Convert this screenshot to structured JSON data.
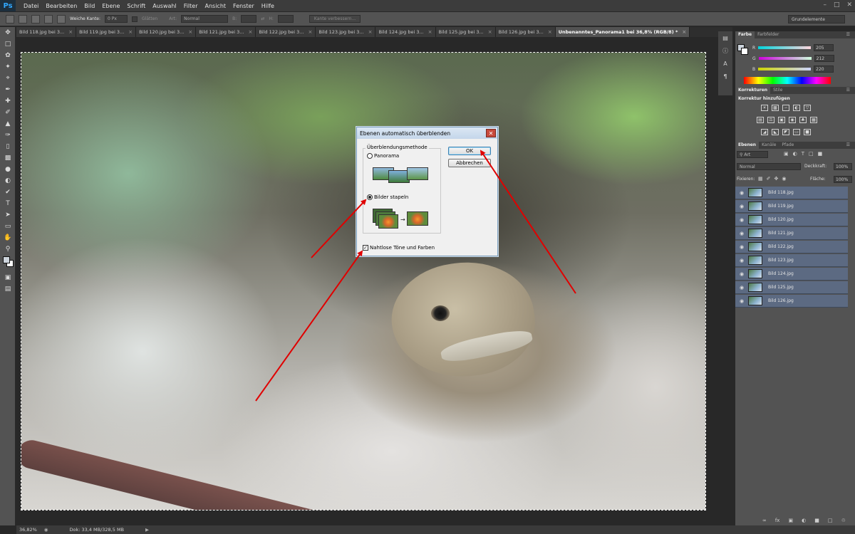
{
  "app": {
    "logo": "Ps",
    "menu": [
      "Datei",
      "Bearbeiten",
      "Bild",
      "Ebene",
      "Schrift",
      "Auswahl",
      "Filter",
      "Ansicht",
      "Fenster",
      "Hilfe"
    ]
  },
  "options": {
    "feather_label": "Weiche Kante:",
    "feather_value": "0 Px",
    "smooth_label": "Glätten",
    "style_label": "Art:",
    "style_value": "Normal",
    "width_label": "B:",
    "height_label": "H:",
    "refine_button": "Kante verbessern...",
    "workspace": "Grundelemente"
  },
  "tabs": [
    {
      "label": "Bild 118.jpg bei 3..."
    },
    {
      "label": "Bild 119.jpg bei 3..."
    },
    {
      "label": "Bild 120.jpg bei 3..."
    },
    {
      "label": "Bild 121.jpg bei 3..."
    },
    {
      "label": "Bild 122.jpg bei 3..."
    },
    {
      "label": "Bild 123.jpg bei 3..."
    },
    {
      "label": "Bild 124.jpg bei 3..."
    },
    {
      "label": "Bild 125.jpg bei 3..."
    },
    {
      "label": "Bild 126.jpg bei 3..."
    },
    {
      "label": "Unbenanntes_Panorama1 bei 36,8% (RGB/8) *"
    }
  ],
  "dialog": {
    "title": "Ebenen automatisch überblenden",
    "group_label": "Überblendungsmethode",
    "option_panorama": "Panorama",
    "option_stack": "Bilder stapeln",
    "checkbox_label": "Nahtlose Töne und Farben",
    "ok": "OK",
    "cancel": "Abbrechen",
    "selected": "Bilder stapeln",
    "checkbox_checked": true
  },
  "color_panel": {
    "tabs": [
      "Farbe",
      "Farbfelder"
    ],
    "r_label": "R",
    "g_label": "G",
    "b_label": "B",
    "r": "205",
    "g": "212",
    "b": "220"
  },
  "adjust_panel": {
    "tabs": [
      "Korrekturen",
      "Stile"
    ],
    "heading": "Korrektur hinzufügen"
  },
  "layers_panel": {
    "tabs": [
      "Ebenen",
      "Kanäle",
      "Pfade"
    ],
    "filter": "Art",
    "blend": "Normal",
    "opacity_label": "Deckkraft:",
    "opacity": "100%",
    "lock_label": "Fixieren:",
    "fill_label": "Fläche:",
    "fill": "100%",
    "layers": [
      "Bild 118.jpg",
      "Bild 119.jpg",
      "Bild 120.jpg",
      "Bild 121.jpg",
      "Bild 122.jpg",
      "Bild 123.jpg",
      "Bild 124.jpg",
      "Bild 125.jpg",
      "Bild 126.jpg"
    ]
  },
  "status": {
    "zoom": "36,82%",
    "doc": "Dok: 33,4 MB/328,5 MB"
  },
  "colors": {
    "arrow": "#e00000",
    "selected_layer": "#5c6a82"
  }
}
